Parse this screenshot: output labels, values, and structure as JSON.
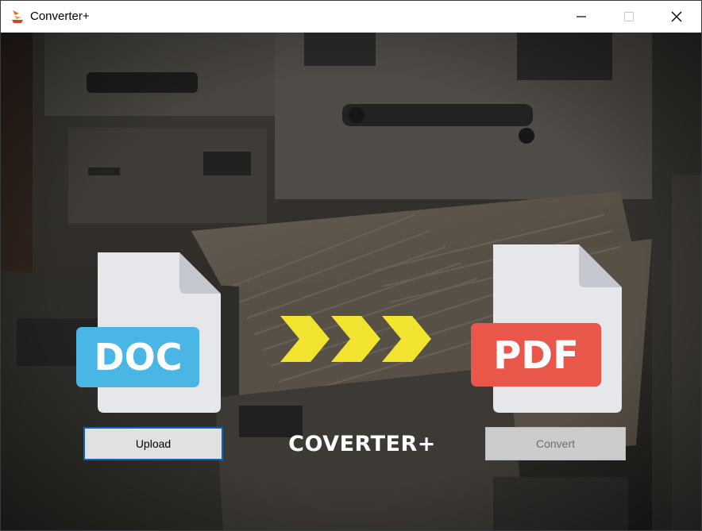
{
  "window": {
    "title": "Converter+",
    "app_icon": "flame-converter-app-icon",
    "controls": [
      "minimize-icon",
      "maximize-icon",
      "close-icon"
    ]
  },
  "hero": {
    "source_format_label": "DOC",
    "target_format_label": "PDF",
    "source_color": "#4ab6e6",
    "target_color": "#e9574a",
    "arrow_color": "#f2e32e",
    "arrow_icon": "triple-chevron-right-icon",
    "background_image": "open filing cabinet drawer"
  },
  "actions": {
    "upload_label": "Upload",
    "convert_label": "Convert"
  },
  "brand": {
    "text": "COVERTER+"
  },
  "colors": {
    "upload_focus_border": "#0a63c7",
    "convert_disabled_bg": "#cccccc"
  }
}
